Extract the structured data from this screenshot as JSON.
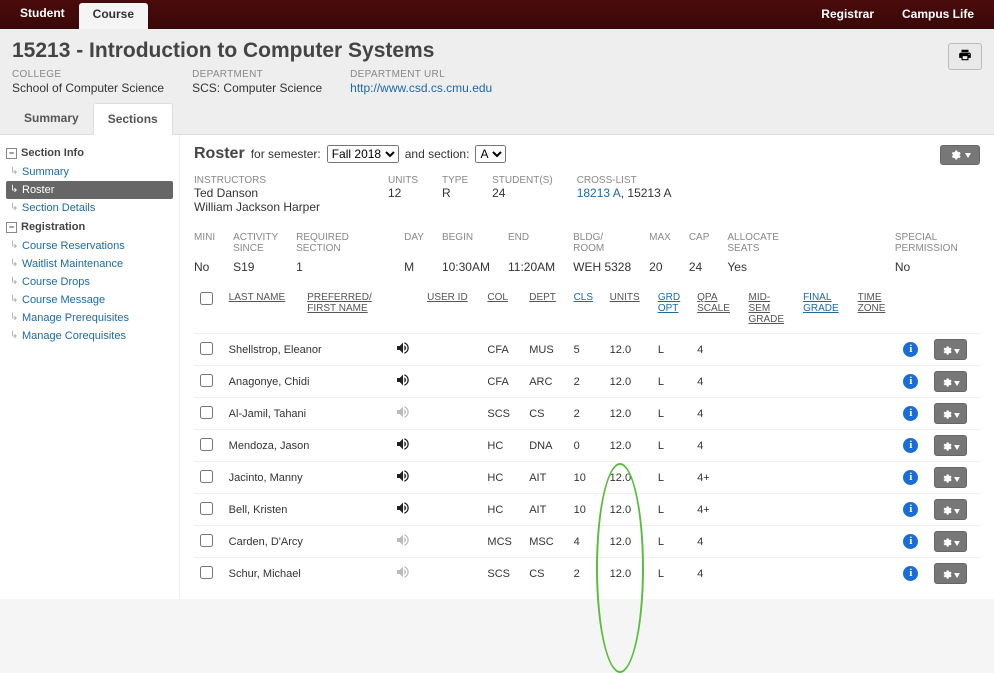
{
  "topnav": {
    "student": "Student",
    "course": "Course",
    "registrar": "Registrar",
    "campus_life": "Campus Life"
  },
  "page_title": "15213 - Introduction to Computer Systems",
  "meta": {
    "college_label": "COLLEGE",
    "college": "School of Computer Science",
    "dept_label": "DEPARTMENT",
    "dept": "SCS: Computer Science",
    "dept_url_label": "DEPARTMENT URL",
    "dept_url": "http://www.csd.cs.cmu.edu"
  },
  "sec_tabs": {
    "summary": "Summary",
    "sections": "Sections"
  },
  "sidebar": {
    "section_info": "Section Info",
    "items_info": [
      "Summary",
      "Roster",
      "Section Details"
    ],
    "registration": "Registration",
    "items_reg": [
      "Course Reservations",
      "Waitlist Maintenance",
      "Course Drops",
      "Course Message",
      "Manage Prerequisites",
      "Manage Corequisites"
    ]
  },
  "roster": {
    "title": "Roster",
    "for_semester": "for semester:",
    "semester_value": "Fall 2018",
    "and_section": "and section:",
    "section_value": "A",
    "instructors_label": "INSTRUCTORS",
    "instructors": [
      "Ted Danson",
      "William Jackson Harper"
    ],
    "units_label": "UNITS",
    "units": "12",
    "type_label": "TYPE",
    "type": "R",
    "students_label": "STUDENT(S)",
    "students": "24",
    "crosslist_label": "CROSS-LIST",
    "crosslist_link": "18213 A",
    "crosslist_rest": ", 15213 A",
    "mini_label": "MINI",
    "mini": "No",
    "activity_label": "ACTIVITY\nSINCE",
    "activity": "S19",
    "reqsec_label": "REQUIRED\nSECTION",
    "reqsec": "1",
    "day_label": "DAY",
    "day": "M",
    "begin_label": "BEGIN",
    "begin": "10:30AM",
    "end_label": "END",
    "end": "11:20AM",
    "room_label": "BLDG/\nROOM",
    "room": "WEH 5328",
    "max_label": "MAX",
    "max": "20",
    "cap_label": "CAP",
    "cap": "24",
    "alloc_label": "ALLOCATE\nSEATS",
    "alloc": "Yes",
    "special_label": "SPECIAL\nPERMISSION",
    "special": "No"
  },
  "table": {
    "headers": {
      "last_name": "LAST NAME",
      "pref_name": "PREFERRED/\nFIRST NAME",
      "user_id": "USER ID",
      "col": "COL",
      "dept": "DEPT",
      "cls": "CLS",
      "units": "UNITS",
      "grd_opt": "GRD\nOPT",
      "qpa_scale": "QPA\nSCALE",
      "mid_sem": "MID-\nSEM\nGRADE",
      "final": "FINAL\nGRADE",
      "tz": "TIME\nZONE"
    },
    "rows": [
      {
        "name": "Shellstrop, Eleanor",
        "audio": true,
        "col": "CFA",
        "dept": "MUS",
        "cls": "5",
        "units": "12.0",
        "grd": "L",
        "qpa": "4"
      },
      {
        "name": "Anagonye, Chidi",
        "audio": true,
        "col": "CFA",
        "dept": "ARC",
        "cls": "2",
        "units": "12.0",
        "grd": "L",
        "qpa": "4"
      },
      {
        "name": "Al-Jamil, Tahani",
        "audio": false,
        "col": "SCS",
        "dept": "CS",
        "cls": "2",
        "units": "12.0",
        "grd": "L",
        "qpa": "4"
      },
      {
        "name": "Mendoza, Jason",
        "audio": true,
        "col": "HC",
        "dept": "DNA",
        "cls": "0",
        "units": "12.0",
        "grd": "L",
        "qpa": "4"
      },
      {
        "name": "Jacinto, Manny",
        "audio": true,
        "col": "HC",
        "dept": "AIT",
        "cls": "10",
        "units": "12.0",
        "grd": "L",
        "qpa": "4+"
      },
      {
        "name": "Bell, Kristen",
        "audio": true,
        "col": "HC",
        "dept": "AIT",
        "cls": "10",
        "units": "12.0",
        "grd": "L",
        "qpa": "4+"
      },
      {
        "name": "Carden, D'Arcy",
        "audio": false,
        "col": "MCS",
        "dept": "MSC",
        "cls": "4",
        "units": "12.0",
        "grd": "L",
        "qpa": "4"
      },
      {
        "name": "Schur, Michael",
        "audio": false,
        "col": "SCS",
        "dept": "CS",
        "cls": "2",
        "units": "12.0",
        "grd": "L",
        "qpa": "4"
      }
    ]
  }
}
